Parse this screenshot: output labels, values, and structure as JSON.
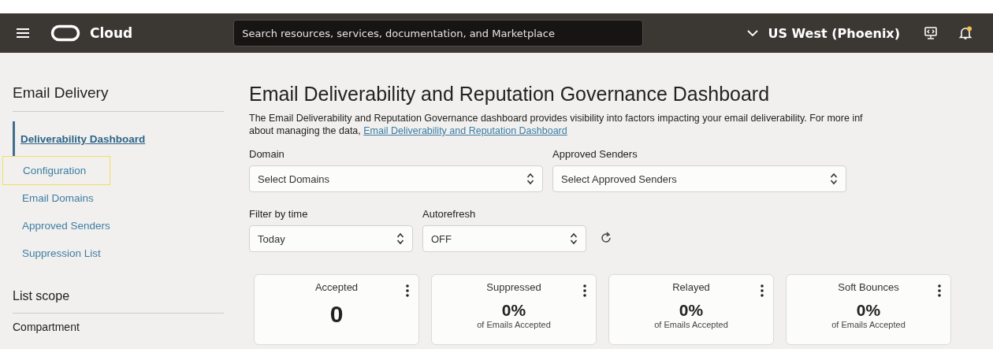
{
  "header": {
    "brand": "Cloud",
    "search": {
      "placeholder": "Search resources, services, documentation, and Marketplace"
    },
    "region": "US West (Phoenix)",
    "notification": true
  },
  "sidebar": {
    "title": "Email Delivery",
    "items": [
      {
        "label": "Deliverability Dashboard",
        "selected": true,
        "highlighted": false
      },
      {
        "label": "Configuration",
        "selected": false,
        "highlighted": true
      },
      {
        "label": "Email Domains",
        "selected": false,
        "highlighted": false
      },
      {
        "label": "Approved Senders",
        "selected": false,
        "highlighted": false
      },
      {
        "label": "Suppression List",
        "selected": false,
        "highlighted": false
      }
    ],
    "scope_title": "List scope",
    "scope_label": "Compartment"
  },
  "main": {
    "title": "Email Deliverability and Reputation Governance Dashboard",
    "description": "The Email Deliverability and Reputation Governance dashboard provides visibility into factors impacting your email deliverability. For more inf",
    "description_2": "about managing the data,",
    "link": "Email Deliverability and Reputation Dashboard",
    "filters": [
      {
        "label": "Domain",
        "value": "Select Domains",
        "kind": "wide"
      },
      {
        "label": "Approved Senders",
        "value": "Select Approved Senders",
        "kind": "wide"
      },
      {
        "label": "Filter by time",
        "value": "Today",
        "kind": "narrow"
      },
      {
        "label": "Autorefresh",
        "value": "OFF",
        "kind": "narrow"
      }
    ],
    "cards": [
      {
        "title": "Accepted",
        "value": "0"
      },
      {
        "title": "Suppressed",
        "value": "0%",
        "subtitle": "of Emails Accepted"
      },
      {
        "title": "Relayed",
        "value": "0%",
        "subtitle": "of Emails Accepted"
      },
      {
        "title": "Soft Bounces",
        "value": "0%",
        "subtitle": "of Emails Accepted"
      }
    ]
  }
}
